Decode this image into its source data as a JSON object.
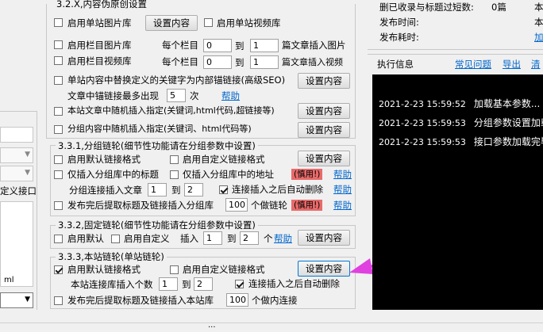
{
  "sidebar": {
    "label_custom_anchor": "定义接口",
    "label_ml": "ml"
  },
  "section_32x": {
    "title": "3.2.X,内容伪原创设置",
    "single_image_lib": "启用单站图片库",
    "single_image_btn": "设置内容",
    "single_video_lib": "启用单站视频库",
    "col_image_lib": "启用栏目图片库",
    "col_video_lib": "启用栏目视频库",
    "per_col": "每个栏目",
    "to": "到",
    "article_insert_image": "篇文章插入图片",
    "article_insert_video": "篇文章插入视频",
    "img_from": "0",
    "img_to": "1",
    "vid_from": "0",
    "vid_to": "1",
    "replace_keywords": "单站内容中替换定义的关键字为内部锚链接(高级SEO)",
    "replace_btn": "设置内容",
    "max_anchor": "文章中锚链接最多出现",
    "max_anchor_val": "5",
    "times": "次",
    "help": "帮助",
    "random_insert": "本站文章中随机插入指定(关键词,html代码,超链接等)",
    "random_insert_btn": "设置内容",
    "group_random_insert": "分组内容中随机插入指定(关键词、html代码等)",
    "group_random_btn": "设置内容"
  },
  "section_331": {
    "title": "3.3.1,分组链轮(细节性功能请在分组参数中设置)",
    "default_link": "启用默认链接格式",
    "custom_link": "启用自定义链接格式",
    "custom_btn": "设置内容",
    "only_title": "仅插入分组库中的标题",
    "only_url": "仅插入分组库中的地址",
    "warn": "(慎用!)",
    "help": "帮助",
    "per_article": "分组连接插入文章",
    "from": "1",
    "to_label": "到",
    "to": "2",
    "auto_delete": "连接插入之后自动删除",
    "help2": "帮助",
    "publish_extract": "发布完后提取标题及链接插入分组库",
    "count": "100",
    "count_unit": "个做链轮",
    "warn2": "(慎用!)",
    "help3": "帮助"
  },
  "section_332": {
    "title": "3.3.2,固定链轮(细节性功能请在分组参数中设置)",
    "default": "启用默认",
    "custom": "启用自定义",
    "insert": "插入",
    "from": "1",
    "to_label": "到",
    "to": "2",
    "unit": "个",
    "help": "帮助",
    "btn": "设置内容"
  },
  "section_333": {
    "title": "3.3.3,本站链轮(单站链轮)",
    "default_link": "启用默认链接格式",
    "custom_link": "启用自定义链接格式",
    "btn": "设置内容",
    "per_count": "本站连接库插入个数",
    "from": "1",
    "to_label": "到",
    "to": "2",
    "auto_delete": "连接插入之后自动删除",
    "publish_extract": "发布完后提取标题及链接插入本站库",
    "count": "100",
    "count_unit": "个做内连接"
  },
  "right_panel": {
    "stat_delete": "删已收录与标题过短数:",
    "stat_delete_val": "0篇",
    "stat_publish_time": "发布时间:",
    "stat_elapsed": "发布耗时:",
    "right_cut_1": "本",
    "right_cut_2": "本",
    "right_cut_link": "加",
    "exec_info": "执行信息",
    "faq": "常见问题",
    "export": "导出",
    "clear": "清",
    "log": [
      {
        "time": "2021-2-23 15:59:52",
        "msg": "加载基本参数..."
      },
      {
        "time": "2021-2-23 15:59:53",
        "msg": "分组参数设置加载"
      },
      {
        "time": "2021-2-23 15:59:53",
        "msg": "接口参数加载完毕"
      }
    ]
  },
  "statusbar": {
    "grip": "..."
  },
  "colors": {
    "log_bg": "#000000",
    "link": "#0066cc",
    "warn_bg": "#e86a6a",
    "arrow": "#e040e0"
  }
}
